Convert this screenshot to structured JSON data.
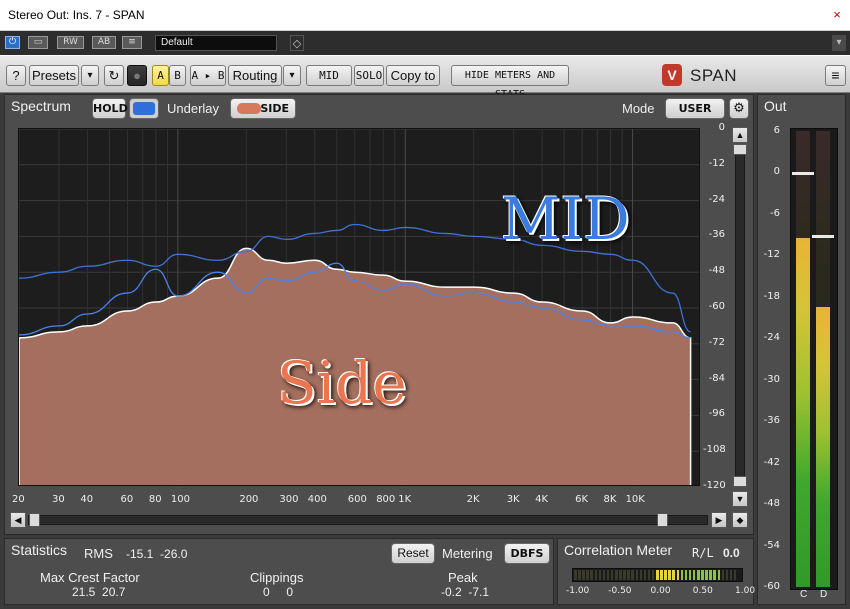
{
  "window": {
    "title": "Stereo Out: Ins. 7 - SPAN",
    "close": "×"
  },
  "host": {
    "buttons": [
      "⏻",
      "▭",
      "RW",
      "AB",
      "≡"
    ],
    "preset": "Default",
    "preset_arrows": "▴▾",
    "diamond": "◇",
    "menu": "▾"
  },
  "toolbar": {
    "help": "?",
    "presets": "Presets",
    "dropdown": "▾",
    "undo": "↻",
    "circle": "●",
    "a": "A",
    "b": "B",
    "atob": "A ▸ B",
    "routing": "Routing",
    "mid": "MID",
    "solo": "SOLO",
    "copy": "Copy to",
    "hide": "HIDE METERS AND STATS",
    "logo": "V",
    "brand": "SPAN",
    "menu": "≡"
  },
  "spectrum": {
    "title": "Spectrum",
    "hold": "HOLD",
    "underlay": "Underlay",
    "side": "SIDE",
    "mode_label": "Mode",
    "mode": "USER",
    "gear": "⚙",
    "overlay_mid": "MID",
    "overlay_side": "Side",
    "y_ticks": [
      "0",
      "-12",
      "-24",
      "-36",
      "-48",
      "-60",
      "-72",
      "-84",
      "-96",
      "-108",
      "-120"
    ],
    "x_ticks": [
      "20",
      "30",
      "40",
      "60",
      "80",
      "100",
      "200",
      "300",
      "400",
      "600",
      "800",
      "1K",
      "2K",
      "3K",
      "4K",
      "6K",
      "8K",
      "10K"
    ]
  },
  "chart_data": {
    "type": "area",
    "xscale": "log",
    "xlim": [
      20,
      20000
    ],
    "ylim": [
      -120,
      0
    ],
    "series": [
      {
        "x": [
          20,
          30,
          40,
          60,
          80,
          100,
          150,
          200,
          250,
          300,
          400,
          500,
          600,
          800,
          1000,
          1500,
          2000,
          3000,
          4000,
          6000,
          8000,
          10000,
          15000,
          18000
        ],
        "values": [
          -70,
          -68,
          -66,
          -61,
          -58,
          -56,
          -50,
          -40,
          -44,
          -45,
          -44,
          -47,
          -48,
          -49,
          -51,
          -53,
          -53,
          -55,
          -58,
          -61,
          -65,
          -63,
          -65,
          -70
        ]
      },
      {
        "x": [
          20,
          30,
          40,
          60,
          80,
          100,
          150,
          200,
          250,
          300,
          400,
          500,
          600,
          800,
          1000,
          1500,
          2000,
          3000,
          4000,
          6000,
          8000,
          10000,
          15000,
          18000
        ],
        "values": [
          -50,
          -48,
          -46,
          -44,
          -46,
          -42,
          -44,
          -41,
          -36,
          -37,
          -35,
          -34,
          -32,
          -34,
          -33,
          -35,
          -36,
          -37,
          -39,
          -41,
          -42,
          -44,
          -55,
          -68
        ]
      },
      {
        "x": [
          20,
          30,
          40,
          60,
          80,
          100,
          150,
          200,
          250,
          300,
          400,
          500,
          600,
          800,
          1000,
          1500,
          2000,
          3000,
          4000,
          6000,
          8000,
          10000,
          15000,
          18000
        ],
        "values": [
          -69,
          -66,
          -62,
          -55,
          -47,
          -56,
          -48,
          -55,
          -50,
          -51,
          -48,
          -45,
          -51,
          -54,
          -52,
          -56,
          -55,
          -58,
          -60,
          -64,
          -66,
          -66,
          -68,
          -70
        ]
      }
    ]
  },
  "out": {
    "title": "Out",
    "ticks": [
      "6",
      "0",
      "-6",
      "-12",
      "-18",
      "-24",
      "-30",
      "-36",
      "-42",
      "-48",
      "-54",
      "-60"
    ],
    "channels": [
      "C",
      "D"
    ],
    "levels": [
      -9.5,
      -19.5
    ],
    "peaks": [
      0,
      -9
    ]
  },
  "stats": {
    "title": "Statistics",
    "rms_label": "RMS",
    "rms": "-15.1  -26.0",
    "reset": "Reset",
    "metering": "Metering",
    "dbfs": "DBFS",
    "crest_label": "Max Crest Factor",
    "crest": "21.5  20.7",
    "clip_label": "Clippings",
    "clip": "0     0",
    "peak_label": "Peak",
    "peak": "-0.2  -7.1"
  },
  "corr": {
    "title": "Correlation Meter",
    "rl": "R/L",
    "value": "0.0",
    "ticks": [
      "-1.00",
      "-0.50",
      "0.00",
      "0.50",
      "1.00"
    ]
  }
}
